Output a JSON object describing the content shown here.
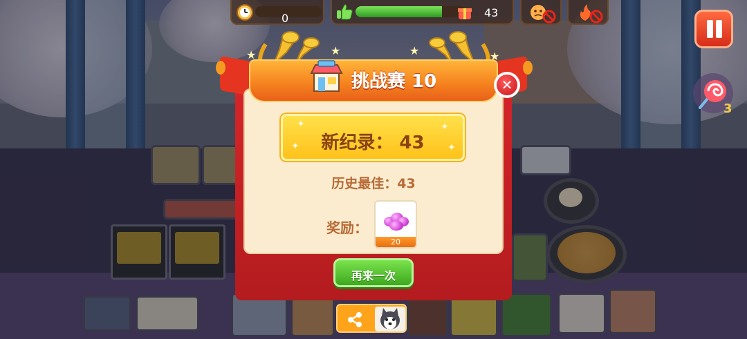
{
  "hud": {
    "timer_value": "0",
    "likes_value": "43",
    "likes_fraction": 0.78,
    "candy_count": "3"
  },
  "dialog": {
    "title": "挑战赛 10",
    "record_text": "新纪录： 43",
    "best_text": "历史最佳：43",
    "reward_label": "奖励：",
    "reward_count": "20",
    "retry_label": "再来一次"
  },
  "icons": {
    "close": "close-icon",
    "pause": "pause-icon",
    "share": "share-icon",
    "timer": "alarm-clock-icon",
    "thumbs": "thumbs-up-icon",
    "gift": "gift-icon",
    "candy": "lollipop-icon",
    "gem": "gem-icon",
    "shop": "shop-icon"
  },
  "colors": {
    "dialog_red": "#d8262a",
    "banner_orange": "#f5801e",
    "record_yellow": "#ffc21a",
    "retry_green": "#3ea820",
    "text_brown": "#b86a36"
  }
}
